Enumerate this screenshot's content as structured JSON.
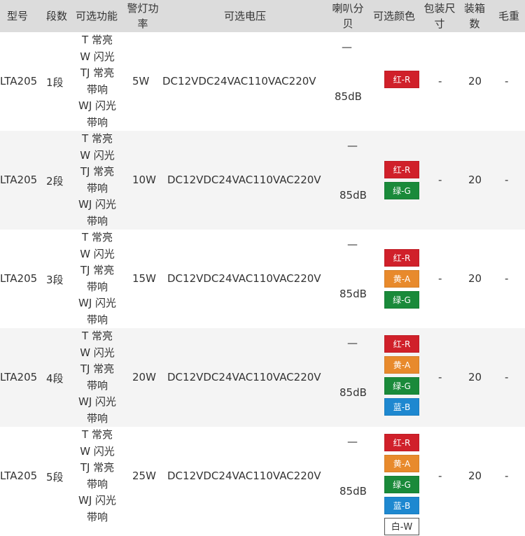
{
  "headers": [
    "型号",
    "段数",
    "可选功能",
    "警灯功率",
    "可选电压",
    "喇叭分贝",
    "可选颜色",
    "包装尺寸",
    "装箱数",
    "毛重"
  ],
  "header_lines": {
    "power": [
      "警灯功",
      "率"
    ],
    "decibel": [
      "喇叭分",
      "贝"
    ],
    "package": [
      "包装尺",
      "寸"
    ],
    "box": [
      "装箱",
      "数"
    ]
  },
  "functions": [
    "T 常亮",
    "W 闪光",
    "TJ 常亮",
    "带响",
    "WJ 闪光",
    "带响"
  ],
  "rows": [
    {
      "model": "LTA205",
      "segments": "1段",
      "power": "5W",
      "voltage": "DC12VDC24VAC110VAC220V",
      "dash": "—",
      "decibel": "85dB",
      "colors": [
        "红-R"
      ],
      "package": "-",
      "box_qty": "20",
      "weight": "-"
    },
    {
      "model": "LTA205",
      "segments": "2段",
      "power": "10W",
      "voltage": "DC12VDC24VAC110VAC220V",
      "dash": "—",
      "decibel": "85dB",
      "colors": [
        "红-R",
        "绿-G"
      ],
      "package": "-",
      "box_qty": "20",
      "weight": "-"
    },
    {
      "model": "LTA205",
      "segments": "3段",
      "power": "15W",
      "voltage": "DC12VDC24VAC110VAC220V",
      "dash": "—",
      "decibel": "85dB",
      "colors": [
        "红-R",
        "黄-A",
        "绿-G"
      ],
      "package": "-",
      "box_qty": "20",
      "weight": "-"
    },
    {
      "model": "LTA205",
      "segments": "4段",
      "power": "20W",
      "voltage": "DC12VDC24VAC110VAC220V",
      "dash": "—",
      "decibel": "85dB",
      "colors": [
        "红-R",
        "黄-A",
        "绿-G",
        "蓝-B"
      ],
      "package": "-",
      "box_qty": "20",
      "weight": "-"
    },
    {
      "model": "LTA205",
      "segments": "5段",
      "power": "25W",
      "voltage": "DC12VDC24VAC110VAC220V",
      "dash": "—",
      "decibel": "85dB",
      "colors": [
        "红-R",
        "黄-A",
        "绿-G",
        "蓝-B",
        "白-W"
      ],
      "package": "-",
      "box_qty": "20",
      "weight": "-"
    }
  ],
  "chip_colors": {
    "红-R": "#d0202a",
    "黄-A": "#e88a2c",
    "绿-G": "#1a8a3a",
    "蓝-B": "#1e88d0",
    "白-W": "#ffffff"
  }
}
